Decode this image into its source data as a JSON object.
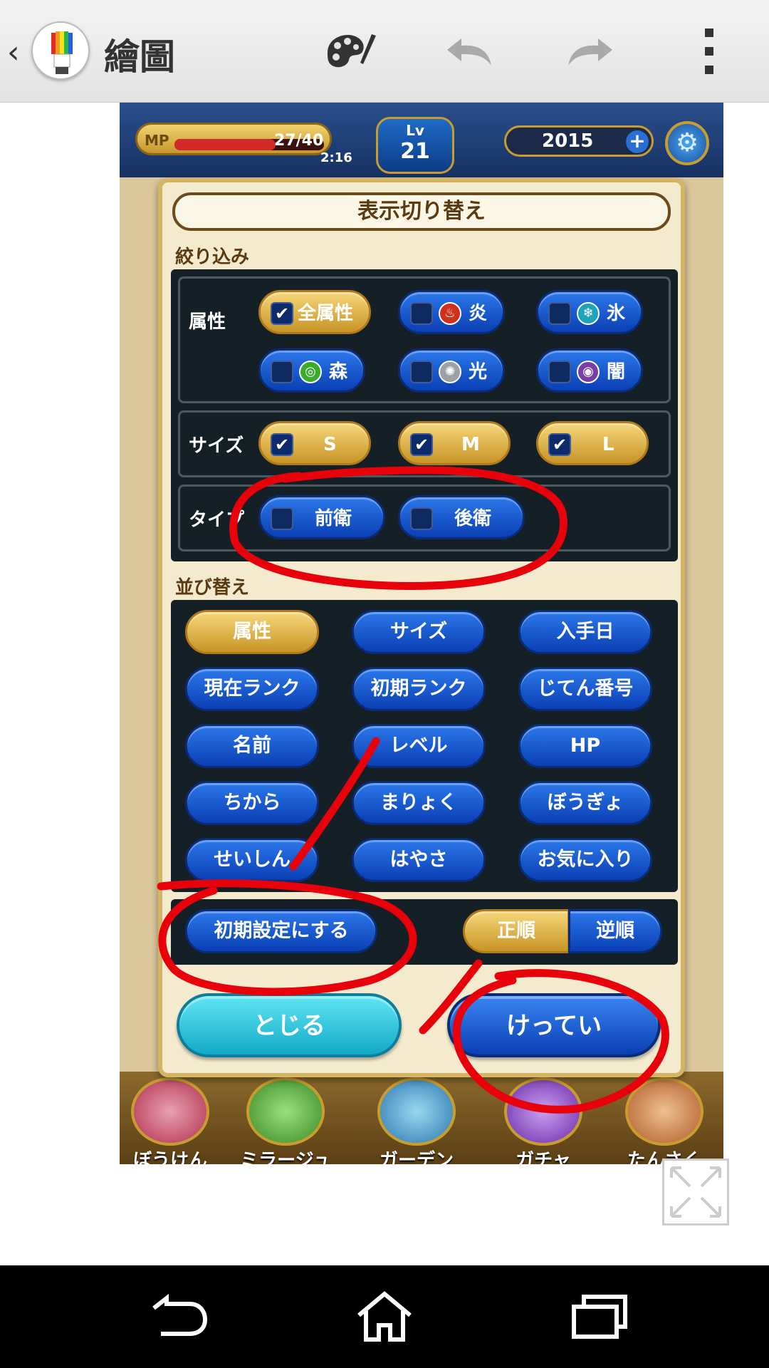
{
  "actionbar": {
    "back_icon": "chevron-left-icon",
    "app_title": "繪圖",
    "icons": [
      "palette-icon",
      "undo-icon",
      "redo-icon",
      "overflow-menu-icon"
    ]
  },
  "game": {
    "mp_label": "MP",
    "mp_value": "27/40",
    "mp_timer": "2:16",
    "mp_fraction": 0.675,
    "lv_label": "Lv",
    "lv_value": "21",
    "gems": "2015",
    "bottom_nav": [
      "ぼうけん",
      "ミラージュ",
      "ガーデン",
      "ガチャ",
      "たんさく"
    ]
  },
  "dialog": {
    "title": "表示切り替え",
    "filter_label": "絞り込み",
    "attribute_label": "属性",
    "attributes": [
      {
        "label": "全属性",
        "checked": true
      },
      {
        "label": "炎",
        "checked": false,
        "color": "#d0301c"
      },
      {
        "label": "氷",
        "checked": false,
        "color": "#1fa3b8"
      },
      {
        "label": "森",
        "checked": false,
        "color": "#3cab2d"
      },
      {
        "label": "光",
        "checked": false,
        "color": "#9aa0a6"
      },
      {
        "label": "闇",
        "checked": false,
        "color": "#7a3ea8"
      }
    ],
    "size_label": "サイズ",
    "sizes": [
      {
        "label": "S",
        "checked": true
      },
      {
        "label": "M",
        "checked": true
      },
      {
        "label": "L",
        "checked": true
      }
    ],
    "type_label": "タイプ",
    "types": [
      {
        "label": "前衛",
        "checked": false
      },
      {
        "label": "後衛",
        "checked": false
      }
    ],
    "sort_label": "並び替え",
    "sort_options": [
      "属性",
      "サイズ",
      "入手日",
      "現在ランク",
      "初期ランク",
      "じてん番号",
      "名前",
      "レベル",
      "HP",
      "ちから",
      "まりょく",
      "ぼうぎょ",
      "せいしん",
      "はやさ",
      "お気に入り"
    ],
    "sort_selected": "属性",
    "reset_label": "初期設定にする",
    "order_asc": "正順",
    "order_desc": "逆順",
    "order_selected": "正順",
    "close_label": "とじる",
    "confirm_label": "けってい"
  },
  "colors": {
    "annotation_red": "#e8000b",
    "gold": "#c89426",
    "blue": "#0a3fb4",
    "cyan": "#14b8d6"
  }
}
